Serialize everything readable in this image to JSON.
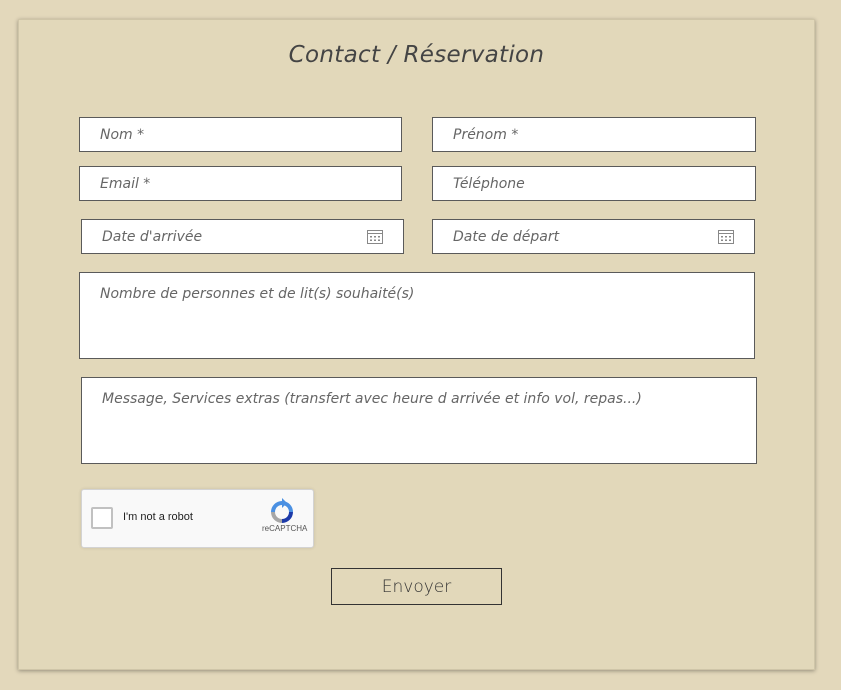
{
  "form": {
    "title": "Contact / Réservation",
    "fields": {
      "nom": {
        "placeholder": "Nom *",
        "value": ""
      },
      "prenom": {
        "placeholder": "Prénom *",
        "value": ""
      },
      "email": {
        "placeholder": "Email *",
        "value": ""
      },
      "telephone": {
        "placeholder": "Téléphone",
        "value": ""
      },
      "date_arrivee": {
        "placeholder": "Date d'arrivée",
        "value": "",
        "icon": "calendar-icon"
      },
      "date_depart": {
        "placeholder": "Date de départ",
        "value": "",
        "icon": "calendar-icon"
      },
      "personnes": {
        "placeholder": "Nombre de personnes et de lit(s) souhaité(s)",
        "value": ""
      },
      "message": {
        "placeholder": "Message, Services extras (transfert avec heure d arrivée et info vol, repas...)",
        "value": ""
      }
    },
    "recaptcha": {
      "label": "I'm not a robot",
      "brand": "reCAPTCHA",
      "checked": false
    },
    "submit_label": "Envoyer"
  },
  "colors": {
    "background": "#e2d8ba",
    "field_border": "#5a5a5a",
    "text": "#444444"
  }
}
